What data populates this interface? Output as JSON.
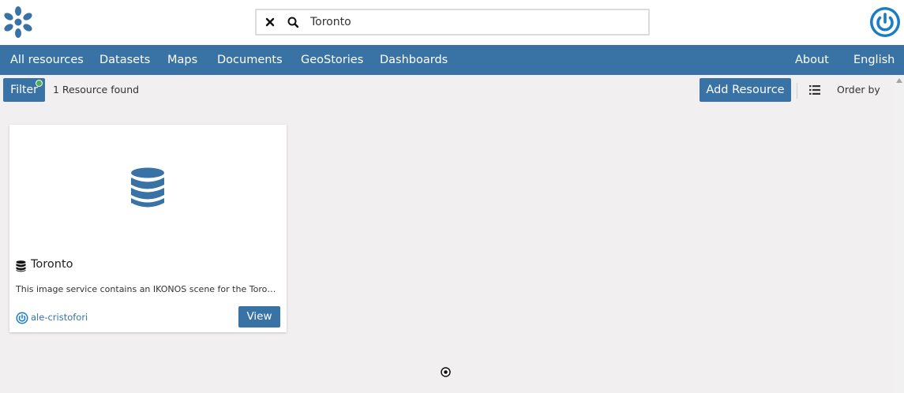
{
  "colors": {
    "primary": "#3973a6",
    "background": "#f1eff0",
    "filter_active": "#4caf50"
  },
  "header": {
    "logo_icon": "geonode-logo-icon",
    "search": {
      "value": "Toronto",
      "placeholder": ""
    },
    "user_icon": "power-user-icon"
  },
  "nav": {
    "items": [
      "All resources",
      "Datasets",
      "Maps",
      "Documents",
      "GeoStories",
      "Dashboards"
    ],
    "right": [
      "About",
      "English"
    ]
  },
  "toolbar": {
    "filter_label": "Filter",
    "results_count": "1 Resource found",
    "add_resource_label": "Add Resource",
    "order_by_label": "Order by"
  },
  "cards": [
    {
      "icon": "database-icon",
      "title": "Toronto",
      "description": "This image service contains an IKONOS scene for the Toronto area",
      "owner": "ale-cristofori",
      "view_label": "View"
    }
  ]
}
